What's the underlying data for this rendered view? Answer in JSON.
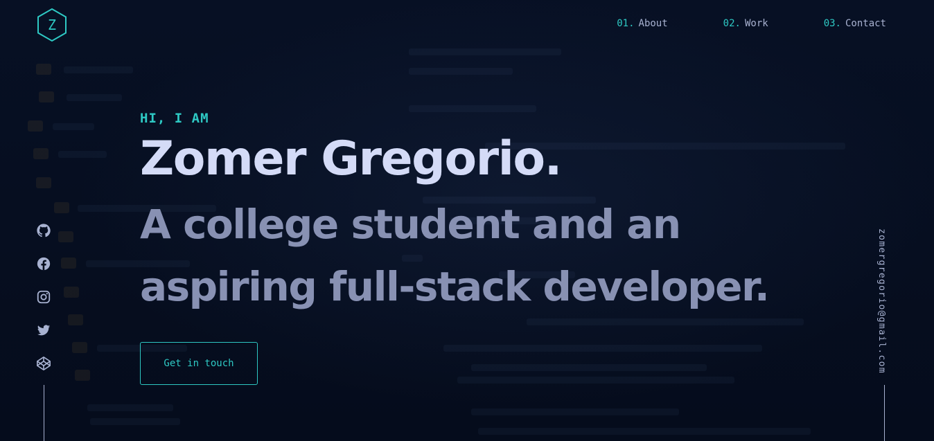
{
  "brand": {
    "logo_letter": "Z",
    "accent": "#2ec9c4"
  },
  "nav": {
    "items": [
      {
        "num": "01.",
        "label": "About"
      },
      {
        "num": "02.",
        "label": "Work"
      },
      {
        "num": "03.",
        "label": "Contact"
      }
    ]
  },
  "hero": {
    "greeting": "HI, I AM",
    "name": "Zomer Gregorio.",
    "tagline": "A college student and an aspiring full-stack developer.",
    "cta_label": "Get in touch"
  },
  "social": {
    "icons": [
      "github-icon",
      "facebook-icon",
      "instagram-icon",
      "twitter-icon",
      "codepen-icon"
    ]
  },
  "email": "zomergregorio@gmail.com",
  "colors": {
    "background": "#050c1c",
    "name": "#d4dbf7",
    "tagline": "#8891b3",
    "nav_text": "#a8b2d1"
  }
}
